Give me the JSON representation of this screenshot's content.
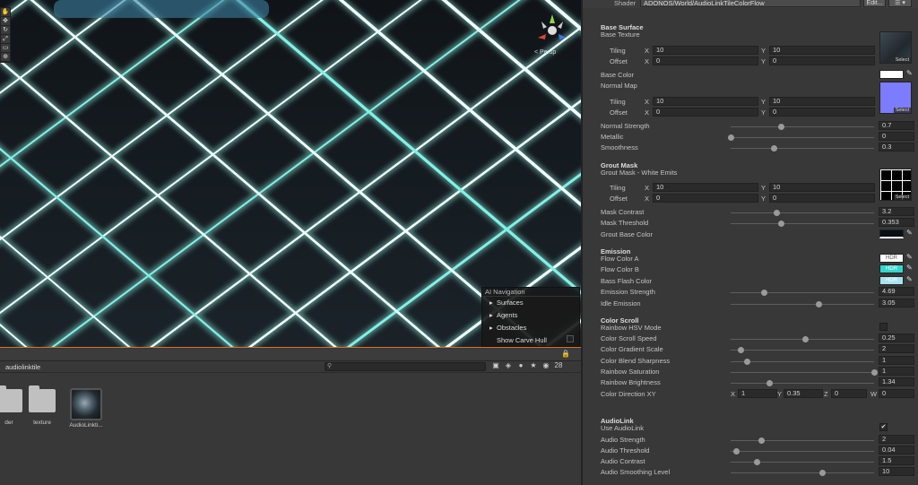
{
  "scene": {
    "persp_label": "< Persp",
    "ai_nav": {
      "title": "AI Navigation",
      "items": [
        {
          "arrow": "▸",
          "label": "Surfaces"
        },
        {
          "arrow": "▸",
          "label": "Agents"
        },
        {
          "arrow": "▸",
          "label": "Obstacles"
        },
        {
          "arrow": "",
          "label": "Show Carve Hull"
        }
      ]
    }
  },
  "project": {
    "breadcrumb": "audiolinktile",
    "badge": "28",
    "assets": [
      {
        "label": "der"
      },
      {
        "label": "texture"
      },
      {
        "label": "AudioLinkti..."
      }
    ]
  },
  "inspector": {
    "shader_label": "Shader",
    "shader_value": "ADONOS/World/AudioLinkTileColorFlow",
    "edit_label": "Edit...",
    "menu_label": "☰ ▾",
    "base": {
      "header": "Base Surface",
      "texture_label": "Base Texture",
      "tiling_label": "Tiling",
      "offset_label": "Offset",
      "tiling_x": "10",
      "tiling_y": "10",
      "offset_x": "0",
      "offset_y": "0",
      "select": "Select",
      "color_label": "Base Color",
      "normal_label": "Normal Map",
      "n_tiling_x": "10",
      "n_tiling_y": "10",
      "n_offset_x": "0",
      "n_offset_y": "0",
      "nselect": "Select"
    },
    "sliders1": [
      {
        "label": "Normal Strength",
        "value": "0.7",
        "pos": 0.35
      },
      {
        "label": "Metallic",
        "value": "0",
        "pos": 0.0
      },
      {
        "label": "Smoothness",
        "value": "0.3",
        "pos": 0.3
      }
    ],
    "grout": {
      "header": "Grout Mask",
      "texture_label": "Grout Mask - White Emits",
      "tiling_x": "10",
      "tiling_y": "10",
      "offset_x": "0",
      "offset_y": "0",
      "select": "Select"
    },
    "sliders2": [
      {
        "label": "Mask Contrast",
        "value": "3.2",
        "pos": 0.32
      },
      {
        "label": "Mask Threshold",
        "value": "0.353",
        "pos": 0.353
      }
    ],
    "grout_base_label": "Grout Base Color",
    "emission": {
      "header": "Emission",
      "flow_a": "Flow Color A",
      "flow_b": "Flow Color B",
      "bass": "Bass Flash Color",
      "hdr": "HDR"
    },
    "sliders3": [
      {
        "label": "Emission Strength",
        "value": "4.69",
        "pos": 0.23
      },
      {
        "label": "Idle Emission",
        "value": "3.05",
        "pos": 0.61
      }
    ],
    "scroll": {
      "header": "Color Scroll",
      "rainbow_hsv": "Rainbow HSV Mode"
    },
    "sliders4": [
      {
        "label": "Color Scroll Speed",
        "value": "0.25",
        "pos": 0.52
      },
      {
        "label": "Color Gradient Scale",
        "value": "2",
        "pos": 0.07
      },
      {
        "label": "Color Blend Sharpness",
        "value": "1",
        "pos": 0.11
      },
      {
        "label": "Rainbow Saturation",
        "value": "1",
        "pos": 1.0
      },
      {
        "label": "Rainbow Brightness",
        "value": "1.34",
        "pos": 0.27
      }
    ],
    "direction": {
      "label": "Color Direction XY",
      "x": "1",
      "y": "0.35",
      "z": "0",
      "w": "0"
    },
    "audiolink": {
      "header": "AudioLink",
      "use_label": "Use AudioLink",
      "check": "✔"
    },
    "sliders5": [
      {
        "label": "Audio Strength",
        "value": "2",
        "pos": 0.21
      },
      {
        "label": "Audio Threshold",
        "value": "0.04",
        "pos": 0.04
      },
      {
        "label": "Audio Contrast",
        "value": "1.5",
        "pos": 0.18
      },
      {
        "label": "Audio Smoothing Level",
        "value": "10",
        "pos": 0.64
      }
    ]
  },
  "colors": {
    "flow_a": "#ffffff",
    "flow_b": "#34d6cf",
    "bass": "#a8e3ee",
    "base": "#ffffff",
    "normal": "#7c7cff",
    "grout_base": "#0b0f14",
    "accent": "#e07020"
  }
}
